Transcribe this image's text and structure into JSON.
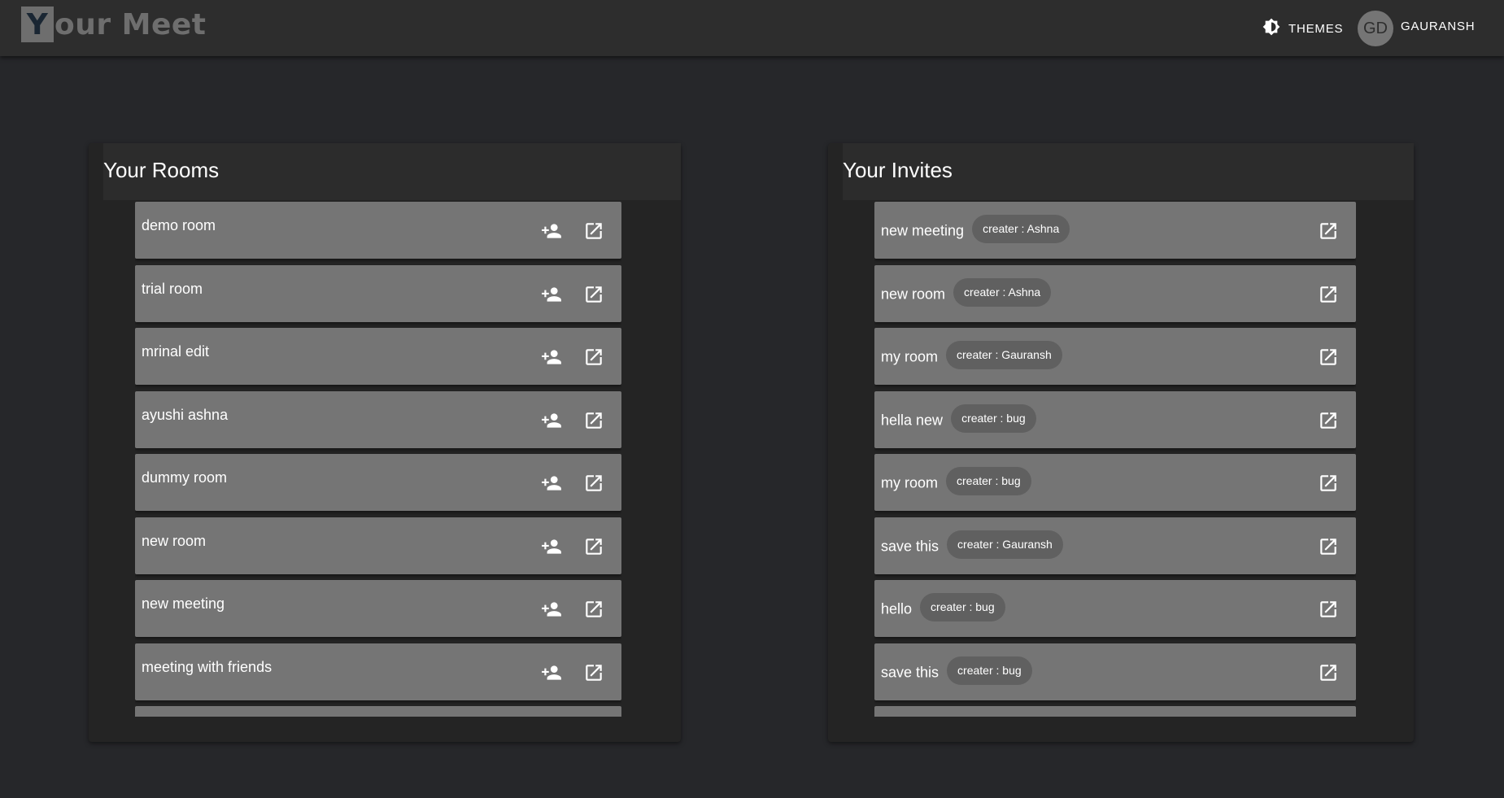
{
  "app": {
    "logo_letter": "Y",
    "logo_rest": "our Meet",
    "themes_label": "THEMES",
    "avatar_initials": "GD",
    "user_name": "GAURANSH"
  },
  "rooms_panel": {
    "title": "Your Rooms",
    "items": [
      {
        "name": "demo room"
      },
      {
        "name": "trial room"
      },
      {
        "name": "mrinal edit"
      },
      {
        "name": "ayushi ashna"
      },
      {
        "name": "dummy room"
      },
      {
        "name": "new room"
      },
      {
        "name": "new meeting"
      },
      {
        "name": "meeting with friends"
      },
      {
        "name": ""
      }
    ]
  },
  "invites_panel": {
    "title": "Your Invites",
    "items": [
      {
        "name": "new meeting",
        "creator": "creater : Ashna"
      },
      {
        "name": "new room",
        "creator": "creater : Ashna"
      },
      {
        "name": "my room",
        "creator": "creater : Gauransh"
      },
      {
        "name": "hella new",
        "creator": "creater : bug"
      },
      {
        "name": "my room",
        "creator": "creater : bug"
      },
      {
        "name": "save this",
        "creator": "creater : Gauransh"
      },
      {
        "name": "hello",
        "creator": "creater : bug"
      },
      {
        "name": "save this",
        "creator": "creater : bug"
      },
      {
        "name": "",
        "creator": ""
      }
    ]
  },
  "icons": {
    "themes": "brightness-icon",
    "invite": "person-add-icon",
    "open": "open-in-new-icon"
  }
}
